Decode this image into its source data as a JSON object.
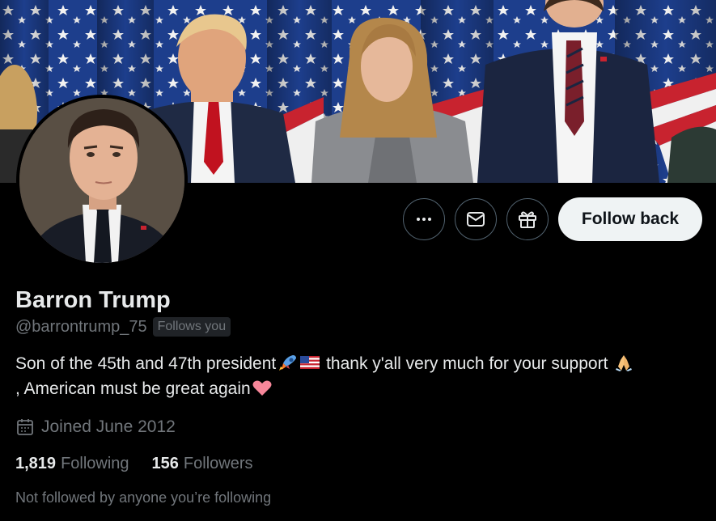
{
  "profile": {
    "display_name": "Barron Trump",
    "handle": "@barrontrump_75",
    "follows_you_badge": "Follows you",
    "bio_line1_part1": "Son of the 45th and 47th president",
    "bio_line1_part2": " thank y'all very much for your support ",
    "bio_line2": ", American must be great again",
    "joined": "Joined June 2012",
    "not_followed_text": "Not followed by anyone you’re following"
  },
  "stats": {
    "following_count": "1,819",
    "following_label": "Following",
    "followers_count": "156",
    "followers_label": "Followers"
  },
  "actions": {
    "follow_back_label": "Follow back",
    "more_icon": "more-icon",
    "message_icon": "envelope-icon",
    "gift_icon": "gift-icon"
  },
  "colors": {
    "background": "#000000",
    "text_primary": "#e7e9ea",
    "text_secondary": "#71767b",
    "button_border": "#536471",
    "follow_button_bg": "#eff3f4"
  }
}
